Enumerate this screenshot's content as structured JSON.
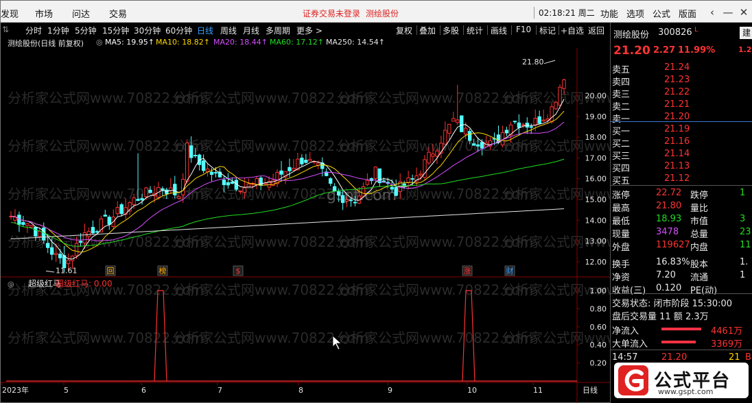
{
  "menu": {
    "items": [
      "发现",
      "市场",
      "问达",
      "交易"
    ],
    "status1": "证券交易未登录",
    "status2": "测绘股份",
    "clock": "02:18:21 周二",
    "right": [
      "功能",
      "选项",
      "公式",
      "版面"
    ]
  },
  "toolbar": {
    "periods": [
      "分时",
      "1分钟",
      "5分钟",
      "15分钟",
      "30分钟",
      "60分钟",
      "日线",
      "周线",
      "月线",
      "多周期",
      "更多 >"
    ],
    "active_period": "日线",
    "tools": [
      "复权",
      "叠加",
      "多股",
      "统计",
      "画线",
      "F10",
      "标记",
      "+自选",
      "返回"
    ]
  },
  "ma": {
    "title": "测绘股份(日线 前复权)",
    "items": [
      {
        "label": "MA5: 19.95",
        "color": "#ffffff"
      },
      {
        "label": "MA10: 18.82",
        "color": "#ffd700"
      },
      {
        "label": "MA20: 18.44",
        "color": "#d64dff"
      },
      {
        "label": "MA60: 17.12",
        "color": "#22dd22"
      },
      {
        "label": "MA250: 14.54",
        "color": "#e6e6e6"
      }
    ]
  },
  "price_axis": {
    "ticks": [
      "20.00",
      "19.00",
      "18.00",
      "17.00",
      "16.00",
      "15.00",
      "14.00",
      "13.00",
      "12.00"
    ],
    "high_label": "21.80",
    "low_label": "11.61"
  },
  "indicator": {
    "name": "超级红马",
    "value_label": "超级红马: 0.00",
    "ticks": [
      "1.00",
      "0.80",
      "0.60",
      "0.40",
      "0.20"
    ]
  },
  "x_axis": {
    "labels": [
      "2023年",
      "5",
      "6",
      "7",
      "8",
      "9",
      "10",
      "11"
    ],
    "period_label": "日线"
  },
  "markers": [
    "回",
    "榜",
    "$",
    "涨",
    "财"
  ],
  "watermark": {
    "site1": "gspt.com",
    "text": "分析家公式网www.70822.com"
  },
  "chart_data": {
    "type": "candlestick",
    "title": "测绘股份(日线 前复权)",
    "price_range": [
      11.3,
      22.3
    ],
    "high": 21.8,
    "low": 11.61,
    "ma_last": {
      "MA5": 19.95,
      "MA10": 18.82,
      "MA20": 18.44,
      "MA60": 17.12,
      "MA250": 14.54
    },
    "indicator_name": "超级红马",
    "indicator_signals": [
      {
        "month": "6",
        "value": 1.0
      },
      {
        "month": "10",
        "value": 1.0
      }
    ],
    "indicator_current": 0.0
  },
  "quote": {
    "name": "测绘股份",
    "code": "300826",
    "tag": "L",
    "price": "21.20",
    "change": "2.27",
    "pct": "11.99%",
    "asks": [
      {
        "label": "卖五",
        "price": "21.24"
      },
      {
        "label": "卖四",
        "price": "21.23"
      },
      {
        "label": "卖三",
        "price": "21.22"
      },
      {
        "label": "卖二",
        "price": "21.21"
      },
      {
        "label": "卖一",
        "price": "21.20"
      }
    ],
    "bids": [
      {
        "label": "买一",
        "price": "21.19"
      },
      {
        "label": "买二",
        "price": "21.16"
      },
      {
        "label": "买三",
        "price": "21.14"
      },
      {
        "label": "买四",
        "price": "21.13"
      },
      {
        "label": "买五",
        "price": "21.12"
      }
    ],
    "stats": [
      {
        "k": "涨停",
        "v": "22.72",
        "k2": "跌停",
        "v2": "1"
      },
      {
        "k": "最高",
        "v": "21.80",
        "k2": "量比",
        "v2": ""
      },
      {
        "k": "最低",
        "v": "18.93",
        "k2": "市值",
        "v2": "3"
      },
      {
        "k": "现量",
        "v": "3478",
        "k2": "总量",
        "v2": "23"
      },
      {
        "k": "外盘",
        "v": "119627",
        "k2": "内盘",
        "v2": "11"
      },
      {
        "k": "换手",
        "v": "16.83%",
        "k2": "股本",
        "v2": "1."
      },
      {
        "k": "净资",
        "v": "7.20",
        "k2": "流通",
        "v2": "1"
      },
      {
        "k": "收益(三)",
        "v": "0.120",
        "k2": "PE(动)",
        "v2": ""
      }
    ],
    "trade_state": "交易状态: 闭市阶段 15:30:00",
    "after_hours": "盘后交易量 11 额 2.3万",
    "net_inflow_label": "净流入",
    "net_inflow": "4461万",
    "big_inflow_label": "大单流入",
    "big_inflow": "3369万",
    "tick_time": "14:57",
    "tick_price": "21.20",
    "tick_vol": "21"
  },
  "brand": {
    "name": "公式平台",
    "site": "www.gspt.com"
  }
}
